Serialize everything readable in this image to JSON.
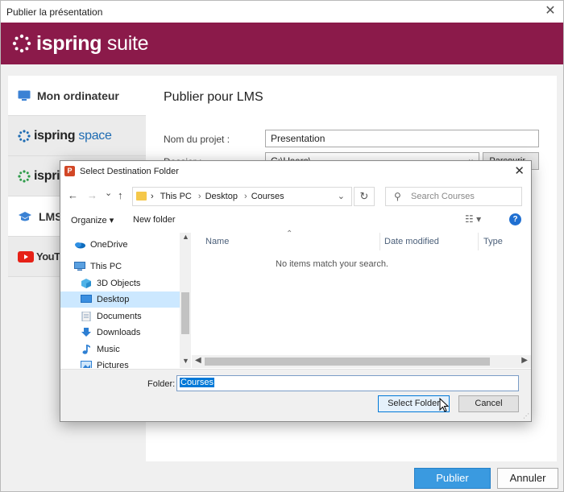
{
  "window": {
    "title": "Publier la présentation",
    "close_glyph": "✕",
    "brand_name_bold": "ispring",
    "brand_name_light": " suite",
    "brand_color": "#8b1a4a"
  },
  "sidebar": {
    "items": [
      {
        "label": "Mon ordinateur",
        "icon": "monitor-icon"
      },
      {
        "label_bold": "ispring",
        "label_light": " space",
        "icon": "ispring-logo-icon"
      },
      {
        "label_bold": "ispri",
        "label_light": "",
        "icon": "ispring-logo-icon"
      },
      {
        "label": "LMS",
        "icon": "graduation-cap-icon"
      },
      {
        "label": "YouTub",
        "icon": "youtube-icon"
      }
    ]
  },
  "main": {
    "title": "Publier pour LMS",
    "project_label": "Nom du projet :",
    "project_value": "Presentation",
    "folder_label": "Dossier :",
    "folder_value": "C:\\Users\\",
    "browse_label": "Parcourir..."
  },
  "footer_buttons": {
    "publish": "Publier",
    "cancel": "Annuler",
    "accent": "#3a9ae0"
  },
  "dialog": {
    "title": "Select Destination Folder",
    "app_icon_letter": "P",
    "close_glyph": "✕",
    "nav": {
      "back": "←",
      "forward": "→",
      "dropdown": "⌄",
      "up": "↑",
      "refresh": "↻"
    },
    "breadcrumb": [
      "This PC",
      "Desktop",
      "Courses"
    ],
    "breadcrumb_sep": "›",
    "search_placeholder": "Search Courses",
    "toolbar": {
      "organize": "Organize ▾",
      "new_folder": "New folder",
      "view_glyph": "☷ ▾",
      "help_glyph": "?"
    },
    "tree": [
      {
        "label": "OneDrive",
        "icon": "onedrive-icon"
      },
      {
        "label": "This PC",
        "icon": "computer-icon"
      },
      {
        "label": "3D Objects",
        "icon": "cube-icon"
      },
      {
        "label": "Desktop",
        "icon": "desktop-icon",
        "selected": true
      },
      {
        "label": "Documents",
        "icon": "document-icon"
      },
      {
        "label": "Downloads",
        "icon": "download-icon"
      },
      {
        "label": "Music",
        "icon": "music-icon"
      },
      {
        "label": "Pictures",
        "icon": "pictures-icon"
      }
    ],
    "columns": [
      "Name",
      "Date modified",
      "Type"
    ],
    "empty_message": "No items match your search.",
    "folder_label": "Folder:",
    "folder_value": "Courses",
    "select_button": "Select Folder",
    "cancel_button": "Cancel"
  }
}
